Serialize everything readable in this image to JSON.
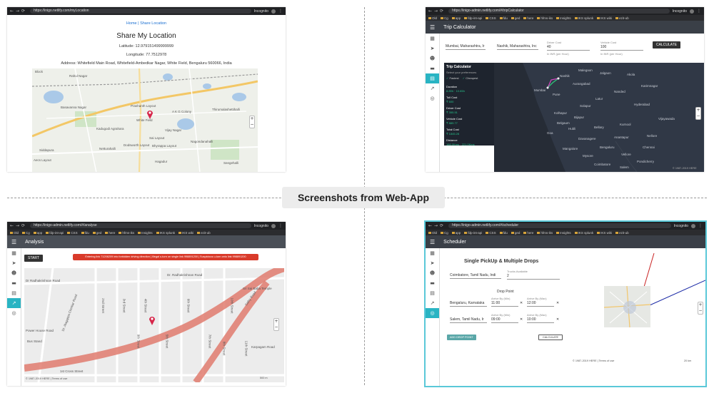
{
  "banner": {
    "title": "Screenshots from Web-App"
  },
  "colors": {
    "accent": "#29b4c3",
    "appbar_dark": "#3a3f47",
    "app_bar_mid": "#4a4f57",
    "alert": "#d93a2a",
    "pin": "#d6264a",
    "route": "#e07b6e"
  },
  "browser": {
    "incognito": "Incognito",
    "bookmarks": [
      "Old",
      "Cg",
      "app",
      "fdp-int-api",
      "CSS",
      "fdu",
      "ged",
      "here",
      "hfms-iks",
      "Insights",
      "IKS splunk",
      "IKS wiki",
      "ezit-ub"
    ]
  },
  "share_location": {
    "url": "https://inigo.netlify.com/myLocation",
    "links": "Home | Share Location",
    "title": "Share My Location",
    "latitude": "Latitude: 12.979151499999999",
    "longitude": "Longitude: 77.7512978",
    "address": "Address: Whitefield Main Road, Whitefield-Ambedkar Nagar, White Field, Bengaluru 560066, India",
    "map_labels": [
      "Block",
      "Rahul Nagar",
      "Basavanna Nagar",
      "Prashanth Layout",
      "White Field",
      "A K G Colony",
      "Thirumalashettihalli",
      "Sai Layout",
      "Vijay Nagar",
      "Kadugodi Agrahara",
      "Dodsworth Layout",
      "Bhyrappa Layout",
      "Nagondanahalli",
      "Netturahalli",
      "Siddapura",
      "Hagadur",
      "Aecs Layout",
      "Seegehalli"
    ],
    "zoom_in": "+",
    "zoom_out": "−"
  },
  "trip_calculator": {
    "url": "https://inigo-admin.netlify.com/#/tripCalculator",
    "title": "Trip Calculator",
    "from": "Mumbai, Maharashtra, Ir",
    "to": "Nashik, Maharashtra, Inc",
    "driver_cost_label": "Driver Cost",
    "driver_cost_value": "40",
    "driver_cost_unit": "In INR (per Hour)",
    "vehicle_cost_label": "Vehicle Cost",
    "vehicle_cost_value": "100",
    "vehicle_cost_unit": "In INR (per Hour)",
    "calculate": "CALCULATE",
    "card": {
      "title": "Trip Calculator",
      "subtitle": "Select your preferences",
      "options": [
        "Fastest",
        "Cheapest"
      ],
      "rows": [
        {
          "label": "Duration",
          "value": "8.89h · 10.65h"
        },
        {
          "label": "Toll Cost",
          "value": "₹ 600"
        },
        {
          "label": "Driver Cost",
          "value": "₹ 355.51"
        },
        {
          "label": "Vehicle Cost",
          "value": "₹ 889.77"
        },
        {
          "label": "Total Cost",
          "value": "₹ 1845.28"
        },
        {
          "label": "Distance",
          "value": "166.0Kms · 221.0Kms"
        }
      ]
    },
    "map_labels": [
      "Nashik",
      "Malegaon",
      "Jalgaon",
      "Akola",
      "Mumbai",
      "Pune",
      "Aurangabad",
      "Latur",
      "Nanded",
      "Hyderabad",
      "Solapur",
      "Kolhapur",
      "Bijapur",
      "Karimnagar",
      "Belgaum",
      "Hubli",
      "Goa",
      "Bellary",
      "Kurnool",
      "Vijayawada",
      "Davanagere",
      "Anantapur",
      "Nellore",
      "Mangalore",
      "Bengaluru",
      "Chennai",
      "Mysore",
      "Vellore",
      "Coimbatore",
      "Pondicherry",
      "Salem"
    ],
    "attribution": "© 1987-2019 HERE"
  },
  "analysis": {
    "url": "https://inigo-admin.netlify.com/#/analyse",
    "title": "Analysis",
    "start": "START",
    "alert": "Entering link 71206209 into forbidden driving direction | Illegal u-turn on single link 998891200 | Suspicious u-turn onto link 998891200",
    "map_labels": [
      "Dr Radhakrishnan Road",
      "Dr. Radhakrishnan Road",
      "Dr. Alagappa Chettiar Road",
      "Sathy Road",
      "1st Cross Street",
      "2nd Street",
      "3rd Street",
      "4th Street",
      "5th Street",
      "6th Street",
      "7th Street",
      "8th Street",
      "9th Street",
      "10th Street",
      "11th Street",
      "Power House Road",
      "Bus Stand",
      "Karpagam Road",
      "Sri Sai Baba Temple"
    ],
    "attribution": "© 1987-2019 HERE | Terms of use",
    "scale": "500 m"
  },
  "scheduler": {
    "url": "https://inigo-admin.netlify.com/#/scheduler",
    "title": "Scheduler",
    "heading": "Single PickUp & Multiple Drops",
    "pickup": "Coimbatore, Tamil Nadu, Indi",
    "trucks_label": "Trucks Available",
    "trucks_value": "2",
    "drop_point_label": "Drop Point",
    "drops": [
      {
        "place": "Bengaluru, Karnataka",
        "by_label": "Arrive By (Min)",
        "by": "11:00",
        "until_label": "Arrive By (Max)",
        "until": "12:00"
      },
      {
        "place": "Salem, Tamil Nadu, Ir",
        "by_label": "Arrive By (Min)",
        "by": "09:00",
        "until_label": "Arrive By (Max)",
        "until": "10:00"
      }
    ],
    "add_drop": "ADD DROP POINT",
    "calculate": "CALCULATE",
    "attribution": "© 1987-2019 HERE | Terms of use",
    "scale": "20 km"
  }
}
